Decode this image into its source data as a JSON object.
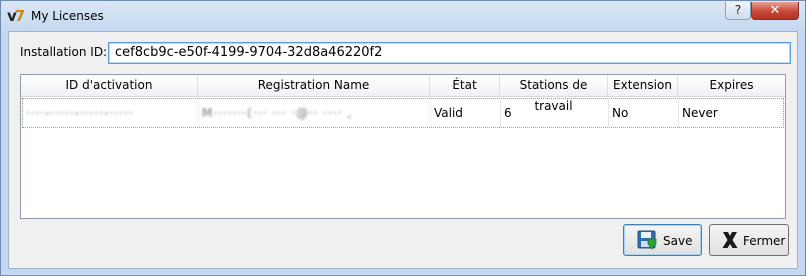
{
  "window": {
    "title": "My Licenses",
    "app_icon_text": "v7",
    "help_label": "?",
    "close_label": "✕"
  },
  "installation": {
    "label": "Installation ID:",
    "value": "cef8cb9c-e50f-4199-9704-32d8a46220f2"
  },
  "table": {
    "headers": [
      "ID d'activation",
      "Registration Name",
      "État",
      "Stations de travail",
      "Extension",
      "Expires"
    ],
    "rows": [
      {
        "activation_id": "····-·····-·····-·····",
        "registration_name": "M·······(··· ··· ·@·· ···· ,",
        "state": "Valid",
        "workstations": "6",
        "extension": "No",
        "expires": "Never"
      }
    ]
  },
  "buttons": {
    "save_label": "Save",
    "close_label": "Fermer"
  },
  "icons": {
    "save": "floppy-disk-icon",
    "close": "x-mark-icon"
  },
  "colors": {
    "accent": "#3c7fb1",
    "close_button": "#c7473a",
    "window_frame": "#c4d8ef"
  }
}
